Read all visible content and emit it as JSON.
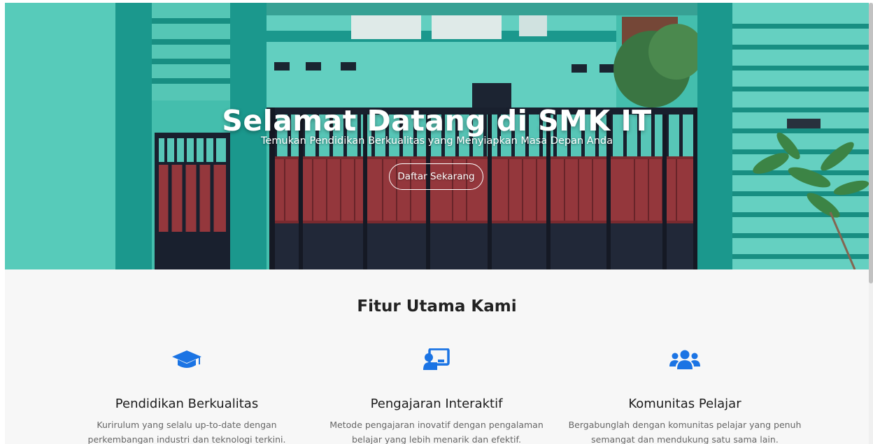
{
  "hero": {
    "title": "Selamat Datang di SMK IT",
    "subtitle": "Temukan Pendidikan Berkualitas yang Menyiapkan Masa Depan Anda",
    "cta_label": "Daftar Sekarang"
  },
  "features": {
    "title": "Fitur Utama Kami",
    "items": [
      {
        "icon": "graduation-cap-icon",
        "title": "Pendidikan Berkualitas",
        "description": "Kurirulum yang selalu up-to-date dengan perkembangan industri dan teknologi terkini."
      },
      {
        "icon": "chalkboard-teacher-icon",
        "title": "Pengajaran Interaktif",
        "description": "Metode pengajaran inovatif dengan pengalaman belajar yang lebih menarik dan efektif."
      },
      {
        "icon": "users-icon",
        "title": "Komunitas Pelajar",
        "description": "Bergabunglah dengan komunitas pelajar yang penuh semangat dan mendukung satu sama lain."
      }
    ]
  },
  "colors": {
    "accent": "#1b74e4",
    "wall_teal": "#3fbfae",
    "gate_red": "#9b3a3f",
    "gate_dark": "#232a3b"
  }
}
